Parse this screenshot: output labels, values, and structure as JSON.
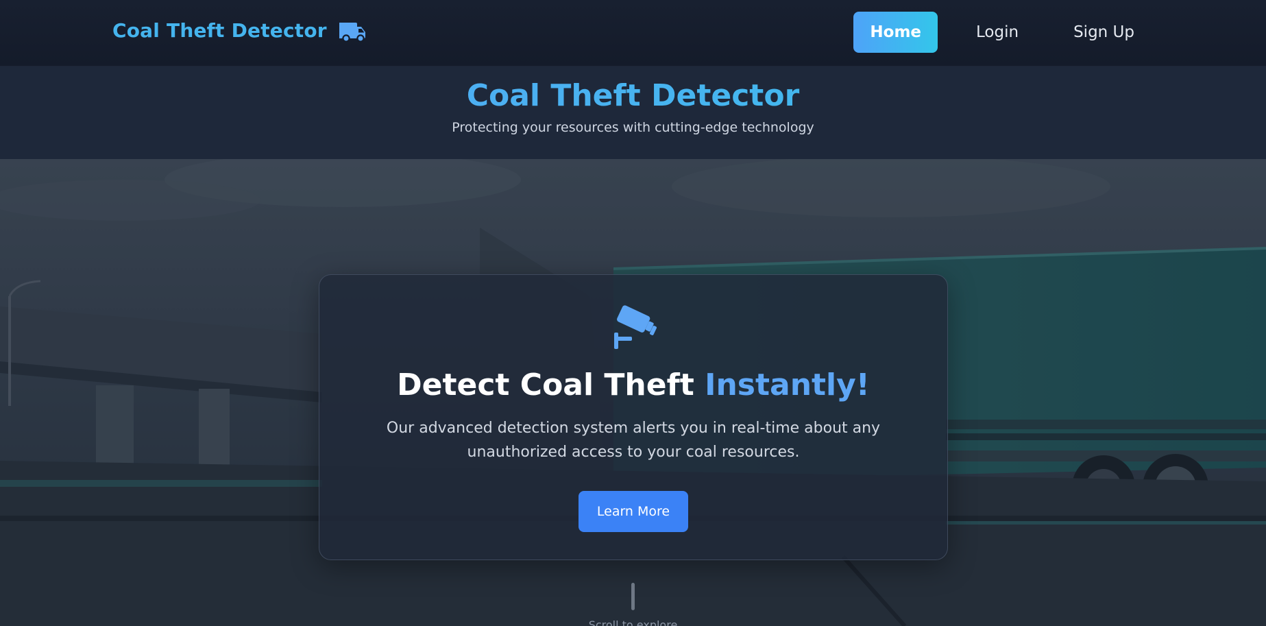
{
  "navbar": {
    "brand": "Coal Theft Detector",
    "brand_icon": "truck-icon",
    "links": [
      {
        "label": "Home",
        "active": true
      },
      {
        "label": "Login",
        "active": false
      },
      {
        "label": "Sign Up",
        "active": false
      }
    ]
  },
  "header": {
    "title": "Coal Theft Detector",
    "subtitle": "Protecting your resources with cutting-edge technology"
  },
  "hero": {
    "icon": "security-camera-icon",
    "heading_main": "Detect Coal Theft ",
    "heading_accent": "Instantly!",
    "description": "Our advanced detection system alerts you in real-time about any unauthorized access to your coal resources.",
    "button_label": "Learn More",
    "scroll_hint": "Scroll to explore"
  },
  "colors": {
    "brand": "#45b4ee",
    "accent": "#5ea6f5",
    "button": "#3b82f6",
    "nav_active_start": "#4ea3f8",
    "nav_active_end": "#33c6ea"
  }
}
